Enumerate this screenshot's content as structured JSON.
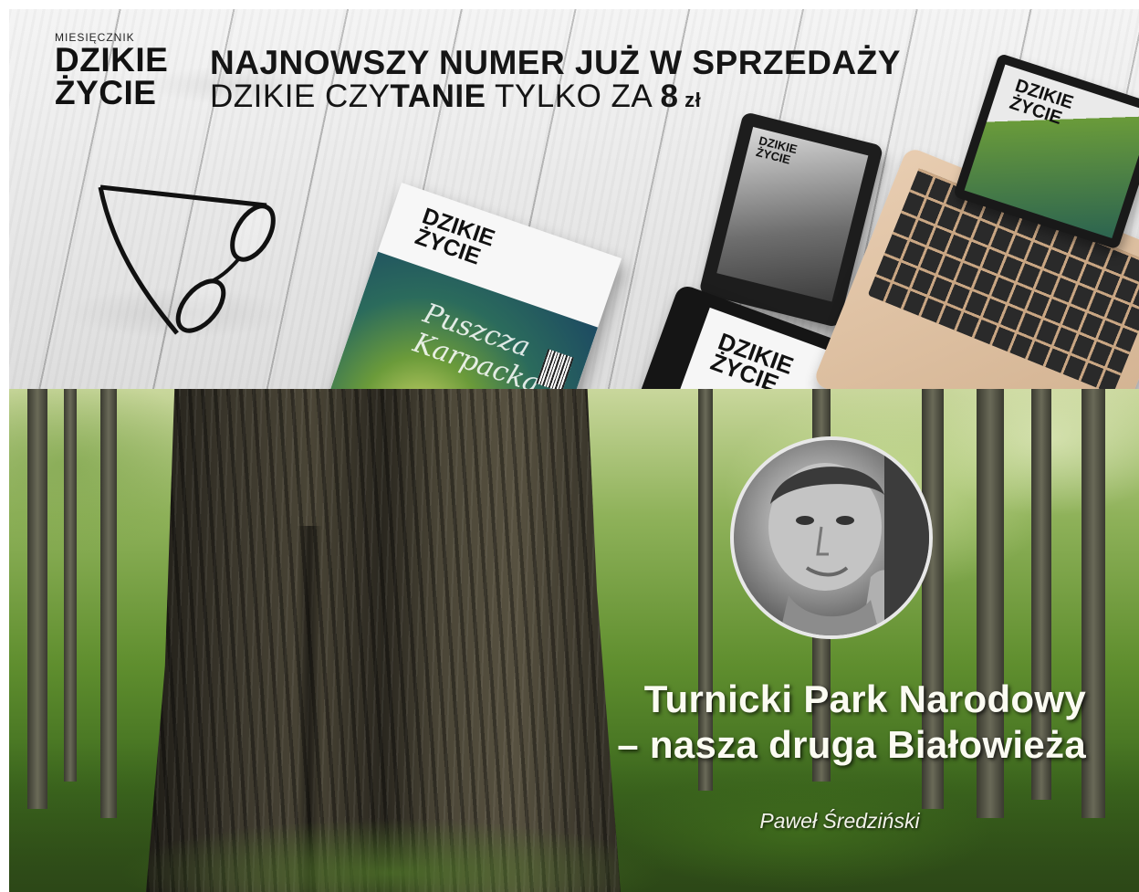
{
  "promo_banner": {
    "logo": {
      "kicker": "MIESIĘCZNIK",
      "line1": "DZIKIE",
      "line2": "ŻYCIE"
    },
    "headline": {
      "main": "NAJNOWSZY NUMER JUŻ W SPRZEDAŻY",
      "sub_prefix": "DZIKIE CZY",
      "sub_bold": "TANIE",
      "sub_middle": " TYLKO ZA ",
      "price": "8",
      "currency": " zł"
    },
    "magazine": {
      "title_line1": "DZIKIE",
      "title_line2": "ŻYCIE",
      "cover_script_line1": "Puszcza",
      "cover_script_line2": "Karpacka"
    },
    "devices": {
      "ereader_title_line1": "DZIKIE",
      "ereader_title_line2": "ŻYCIE",
      "tablet_title_line1": "DZIKIE",
      "tablet_title_line2": "ŻYCIE",
      "laptop_title_line1": "DZIKIE",
      "laptop_title_line2": "ŻYCIE"
    }
  },
  "article_banner": {
    "title_line1": "Turnicki Park Narodowy",
    "title_line2": "– nasza druga Białowieża",
    "author": "Paweł Średziński"
  },
  "colors": {
    "banner_bg": "#e9e9e9",
    "forest_green": "#5f8e2e",
    "title_text": "#fbfbf2"
  }
}
